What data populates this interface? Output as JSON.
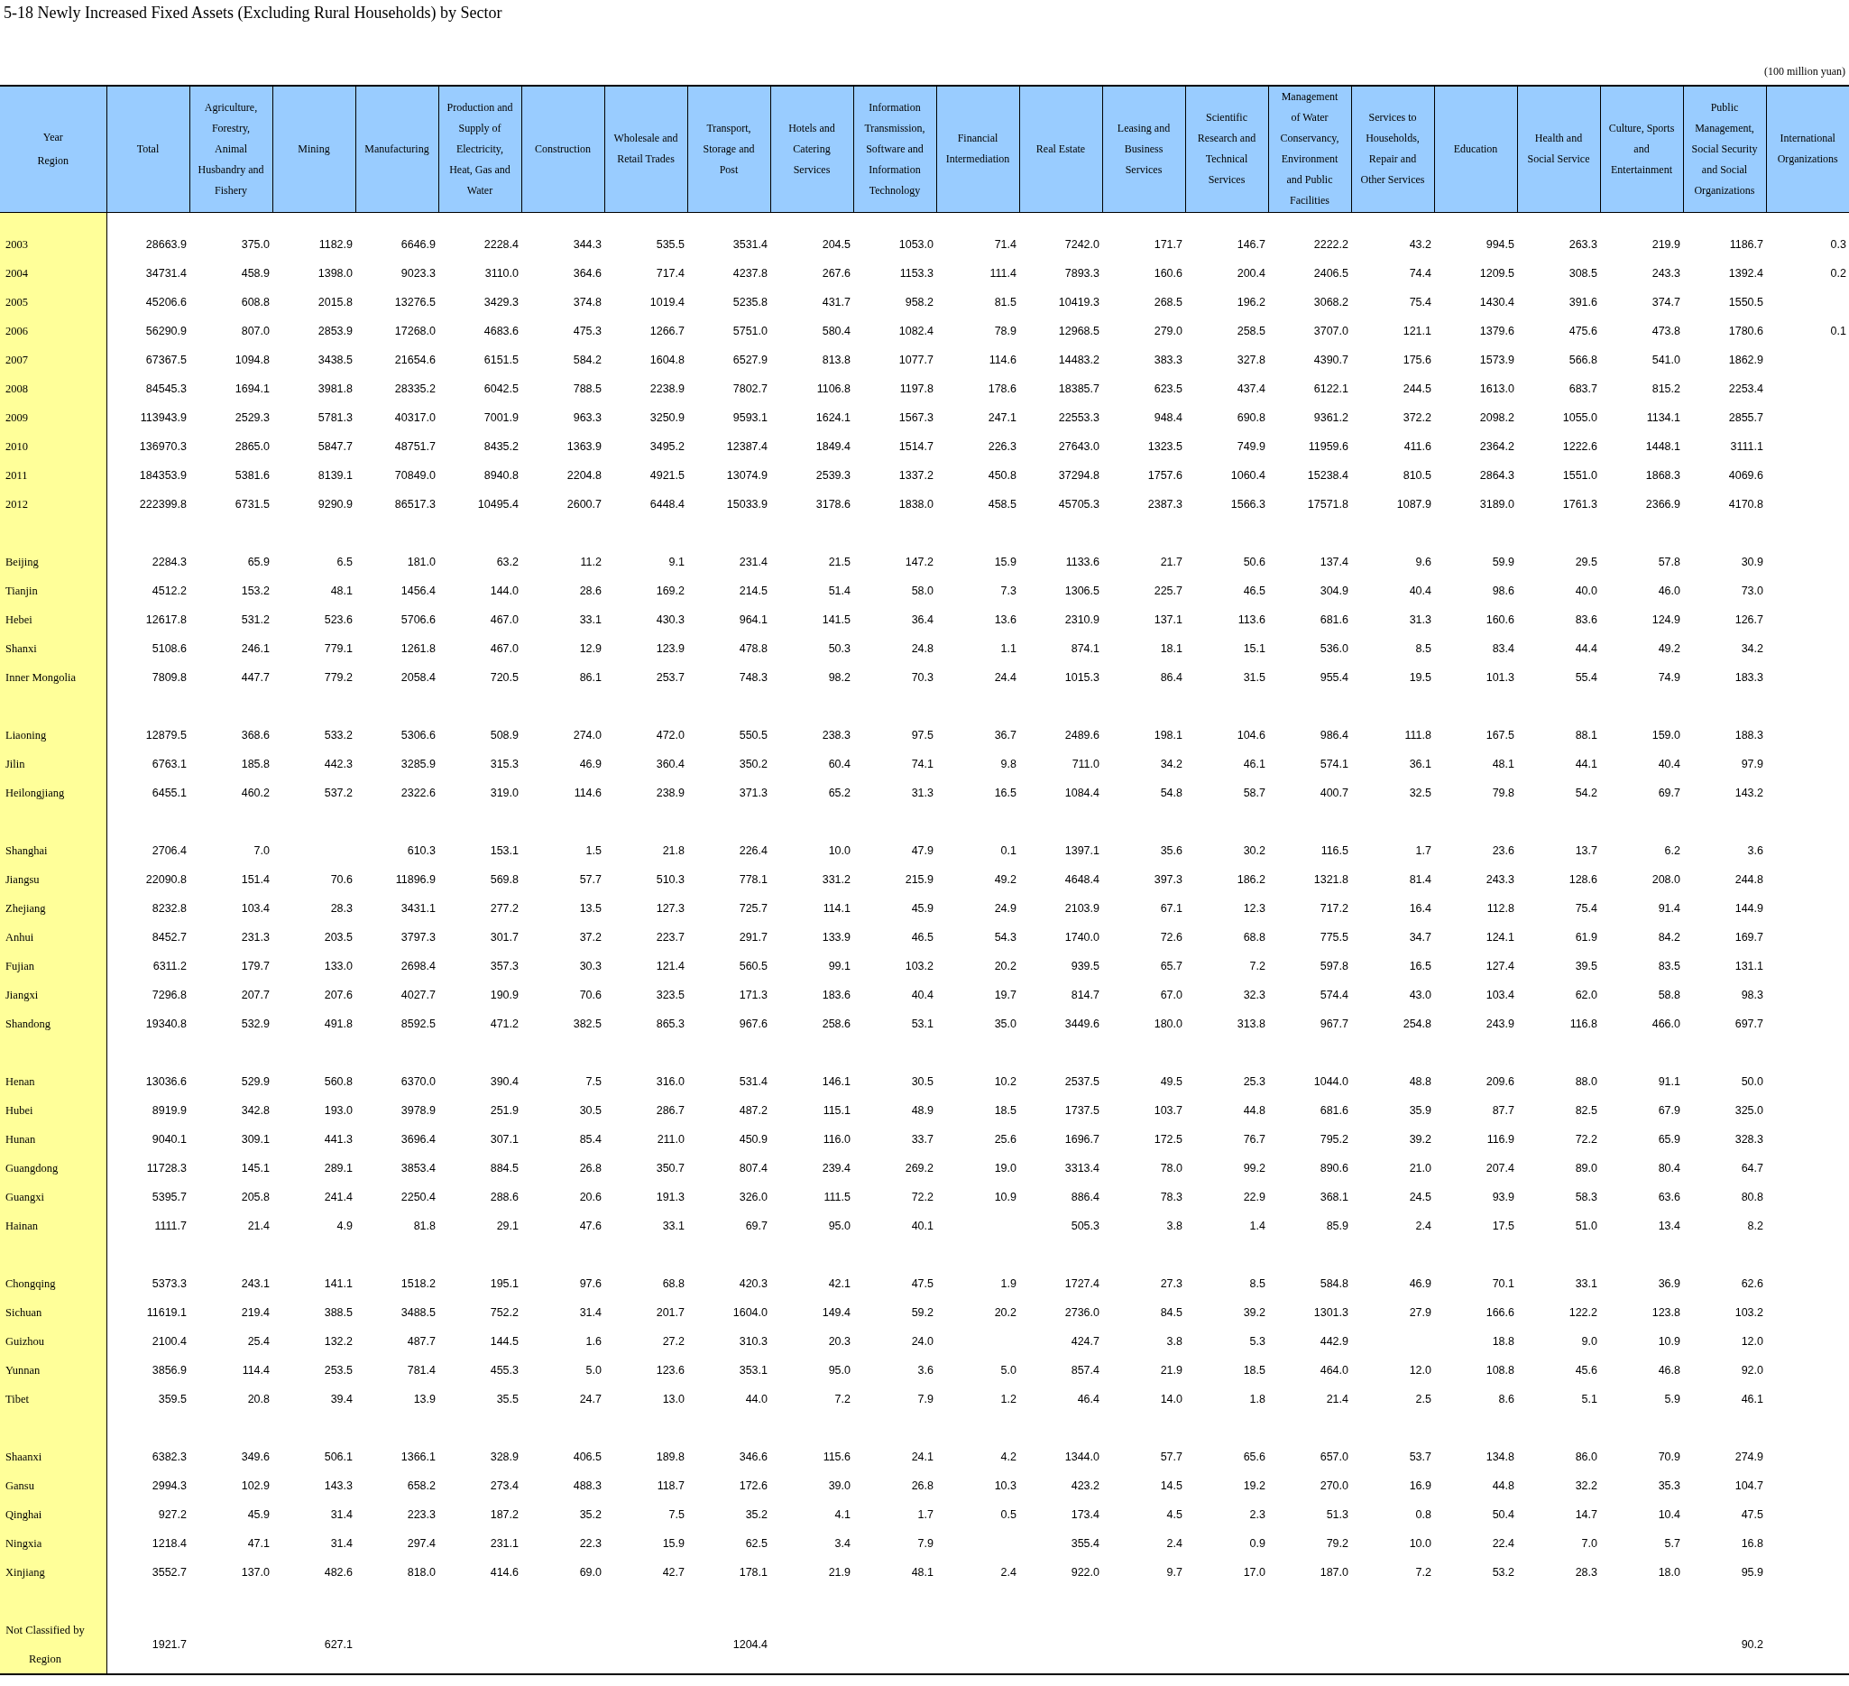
{
  "title": "5-18  Newly Increased Fixed Assets (Excluding Rural Households) by Sector",
  "unit_note": "(100 million yuan)",
  "corner_header": [
    "Year",
    "Region"
  ],
  "columns": [
    "Total",
    "Agriculture, Forestry, Animal Husbandry and Fishery",
    "Mining",
    "Manufacturing",
    "Production and Supply of Electricity, Heat, Gas and Water",
    "Construction",
    "Wholesale and Retail Trades",
    "Transport, Storage and Post",
    "Hotels and Catering Services",
    "Information Transmission, Software and Information Technology",
    "Financial Intermediation",
    "Real Estate",
    "Leasing and Business Services",
    "Scientific Research and Technical Services",
    "Management of Water Conservancy, Environment and Public Facilities",
    "Services to Households, Repair and Other Services",
    "Education",
    "Health and Social Service",
    "Culture, Sports and Entertainment",
    "Public Management, Social Security and Social Organizations",
    "International Organizations"
  ],
  "row_groups": [
    [
      {
        "label": "2003",
        "values": [
          "28663.9",
          "375.0",
          "1182.9",
          "6646.9",
          "2228.4",
          "344.3",
          "535.5",
          "3531.4",
          "204.5",
          "1053.0",
          "71.4",
          "7242.0",
          "171.7",
          "146.7",
          "2222.2",
          "43.2",
          "994.5",
          "263.3",
          "219.9",
          "1186.7",
          "0.3"
        ]
      },
      {
        "label": "2004",
        "values": [
          "34731.4",
          "458.9",
          "1398.0",
          "9023.3",
          "3110.0",
          "364.6",
          "717.4",
          "4237.8",
          "267.6",
          "1153.3",
          "111.4",
          "7893.3",
          "160.6",
          "200.4",
          "2406.5",
          "74.4",
          "1209.5",
          "308.5",
          "243.3",
          "1392.4",
          "0.2"
        ]
      },
      {
        "label": "2005",
        "values": [
          "45206.6",
          "608.8",
          "2015.8",
          "13276.5",
          "3429.3",
          "374.8",
          "1019.4",
          "5235.8",
          "431.7",
          "958.2",
          "81.5",
          "10419.3",
          "268.5",
          "196.2",
          "3068.2",
          "75.4",
          "1430.4",
          "391.6",
          "374.7",
          "1550.5"
        ]
      },
      {
        "label": "2006",
        "values": [
          "56290.9",
          "807.0",
          "2853.9",
          "17268.0",
          "4683.6",
          "475.3",
          "1266.7",
          "5751.0",
          "580.4",
          "1082.4",
          "78.9",
          "12968.5",
          "279.0",
          "258.5",
          "3707.0",
          "121.1",
          "1379.6",
          "475.6",
          "473.8",
          "1780.6",
          "0.1"
        ]
      },
      {
        "label": "2007",
        "values": [
          "67367.5",
          "1094.8",
          "3438.5",
          "21654.6",
          "6151.5",
          "584.2",
          "1604.8",
          "6527.9",
          "813.8",
          "1077.7",
          "114.6",
          "14483.2",
          "383.3",
          "327.8",
          "4390.7",
          "175.6",
          "1573.9",
          "566.8",
          "541.0",
          "1862.9"
        ]
      },
      {
        "label": "2008",
        "values": [
          "84545.3",
          "1694.1",
          "3981.8",
          "28335.2",
          "6042.5",
          "788.5",
          "2238.9",
          "7802.7",
          "1106.8",
          "1197.8",
          "178.6",
          "18385.7",
          "623.5",
          "437.4",
          "6122.1",
          "244.5",
          "1613.0",
          "683.7",
          "815.2",
          "2253.4"
        ]
      },
      {
        "label": "2009",
        "values": [
          "113943.9",
          "2529.3",
          "5781.3",
          "40317.0",
          "7001.9",
          "963.3",
          "3250.9",
          "9593.1",
          "1624.1",
          "1567.3",
          "247.1",
          "22553.3",
          "948.4",
          "690.8",
          "9361.2",
          "372.2",
          "2098.2",
          "1055.0",
          "1134.1",
          "2855.7"
        ]
      },
      {
        "label": "2010",
        "values": [
          "136970.3",
          "2865.0",
          "5847.7",
          "48751.7",
          "8435.2",
          "1363.9",
          "3495.2",
          "12387.4",
          "1849.4",
          "1514.7",
          "226.3",
          "27643.0",
          "1323.5",
          "749.9",
          "11959.6",
          "411.6",
          "2364.2",
          "1222.6",
          "1448.1",
          "3111.1"
        ]
      },
      {
        "label": "2011",
        "values": [
          "184353.9",
          "5381.6",
          "8139.1",
          "70849.0",
          "8940.8",
          "2204.8",
          "4921.5",
          "13074.9",
          "2539.3",
          "1337.2",
          "450.8",
          "37294.8",
          "1757.6",
          "1060.4",
          "15238.4",
          "810.5",
          "2864.3",
          "1551.0",
          "1868.3",
          "4069.6"
        ]
      },
      {
        "label": "2012",
        "values": [
          "222399.8",
          "6731.5",
          "9290.9",
          "86517.3",
          "10495.4",
          "2600.7",
          "6448.4",
          "15033.9",
          "3178.6",
          "1838.0",
          "458.5",
          "45705.3",
          "2387.3",
          "1566.3",
          "17571.8",
          "1087.9",
          "3189.0",
          "1761.3",
          "2366.9",
          "4170.8"
        ]
      }
    ],
    [
      {
        "label": "Beijing",
        "values": [
          "2284.3",
          "65.9",
          "6.5",
          "181.0",
          "63.2",
          "11.2",
          "9.1",
          "231.4",
          "21.5",
          "147.2",
          "15.9",
          "1133.6",
          "21.7",
          "50.6",
          "137.4",
          "9.6",
          "59.9",
          "29.5",
          "57.8",
          "30.9"
        ]
      },
      {
        "label": "Tianjin",
        "values": [
          "4512.2",
          "153.2",
          "48.1",
          "1456.4",
          "144.0",
          "28.6",
          "169.2",
          "214.5",
          "51.4",
          "58.0",
          "7.3",
          "1306.5",
          "225.7",
          "46.5",
          "304.9",
          "40.4",
          "98.6",
          "40.0",
          "46.0",
          "73.0"
        ]
      },
      {
        "label": "Hebei",
        "values": [
          "12617.8",
          "531.2",
          "523.6",
          "5706.6",
          "467.0",
          "33.1",
          "430.3",
          "964.1",
          "141.5",
          "36.4",
          "13.6",
          "2310.9",
          "137.1",
          "113.6",
          "681.6",
          "31.3",
          "160.6",
          "83.6",
          "124.9",
          "126.7"
        ]
      },
      {
        "label": "Shanxi",
        "values": [
          "5108.6",
          "246.1",
          "779.1",
          "1261.8",
          "467.0",
          "12.9",
          "123.9",
          "478.8",
          "50.3",
          "24.8",
          "1.1",
          "874.1",
          "18.1",
          "15.1",
          "536.0",
          "8.5",
          "83.4",
          "44.4",
          "49.2",
          "34.2"
        ]
      },
      {
        "label": "Inner Mongolia",
        "values": [
          "7809.8",
          "447.7",
          "779.2",
          "2058.4",
          "720.5",
          "86.1",
          "253.7",
          "748.3",
          "98.2",
          "70.3",
          "24.4",
          "1015.3",
          "86.4",
          "31.5",
          "955.4",
          "19.5",
          "101.3",
          "55.4",
          "74.9",
          "183.3"
        ]
      }
    ],
    [
      {
        "label": "Liaoning",
        "values": [
          "12879.5",
          "368.6",
          "533.2",
          "5306.6",
          "508.9",
          "274.0",
          "472.0",
          "550.5",
          "238.3",
          "97.5",
          "36.7",
          "2489.6",
          "198.1",
          "104.6",
          "986.4",
          "111.8",
          "167.5",
          "88.1",
          "159.0",
          "188.3"
        ]
      },
      {
        "label": "Jilin",
        "values": [
          "6763.1",
          "185.8",
          "442.3",
          "3285.9",
          "315.3",
          "46.9",
          "360.4",
          "350.2",
          "60.4",
          "74.1",
          "9.8",
          "711.0",
          "34.2",
          "46.1",
          "574.1",
          "36.1",
          "48.1",
          "44.1",
          "40.4",
          "97.9"
        ]
      },
      {
        "label": "Heilongjiang",
        "values": [
          "6455.1",
          "460.2",
          "537.2",
          "2322.6",
          "319.0",
          "114.6",
          "238.9",
          "371.3",
          "65.2",
          "31.3",
          "16.5",
          "1084.4",
          "54.8",
          "58.7",
          "400.7",
          "32.5",
          "79.8",
          "54.2",
          "69.7",
          "143.2"
        ]
      }
    ],
    [
      {
        "label": "Shanghai",
        "values": [
          "2706.4",
          "7.0",
          {
            "kind": "blank"
          },
          "610.3",
          "153.1",
          "1.5",
          "21.8",
          "226.4",
          "10.0",
          "47.9",
          "0.1",
          "1397.1",
          "35.6",
          "30.2",
          "116.5",
          "1.7",
          "23.6",
          "13.7",
          "6.2",
          "3.6"
        ]
      },
      {
        "label": "Jiangsu",
        "values": [
          "22090.8",
          "151.4",
          "70.6",
          "11896.9",
          "569.8",
          "57.7",
          "510.3",
          "778.1",
          "331.2",
          "215.9",
          "49.2",
          "4648.4",
          "397.3",
          "186.2",
          "1321.8",
          "81.4",
          "243.3",
          "128.6",
          "208.0",
          "244.8"
        ]
      },
      {
        "label": "Zhejiang",
        "values": [
          "8232.8",
          "103.4",
          "28.3",
          "3431.1",
          "277.2",
          "13.5",
          "127.3",
          "725.7",
          "114.1",
          "45.9",
          "24.9",
          "2103.9",
          "67.1",
          "12.3",
          "717.2",
          "16.4",
          "112.8",
          "75.4",
          "91.4",
          "144.9"
        ]
      },
      {
        "label": "Anhui",
        "values": [
          "8452.7",
          "231.3",
          "203.5",
          "3797.3",
          "301.7",
          "37.2",
          "223.7",
          "291.7",
          "133.9",
          "46.5",
          "54.3",
          "1740.0",
          "72.6",
          "68.8",
          "775.5",
          "34.7",
          "124.1",
          "61.9",
          "84.2",
          "169.7"
        ]
      },
      {
        "label": "Fujian",
        "values": [
          "6311.2",
          "179.7",
          "133.0",
          "2698.4",
          "357.3",
          "30.3",
          "121.4",
          "560.5",
          "99.1",
          "103.2",
          "20.2",
          "939.5",
          "65.7",
          "7.2",
          "597.8",
          "16.5",
          "127.4",
          "39.5",
          "83.5",
          "131.1"
        ]
      },
      {
        "label": "Jiangxi",
        "values": [
          "7296.8",
          "207.7",
          "207.6",
          "4027.7",
          "190.9",
          "70.6",
          "323.5",
          "171.3",
          "183.6",
          "40.4",
          "19.7",
          "814.7",
          "67.0",
          "32.3",
          "574.4",
          "43.0",
          "103.4",
          "62.0",
          "58.8",
          "98.3"
        ]
      },
      {
        "label": "Shandong",
        "values": [
          "19340.8",
          "532.9",
          "491.8",
          "8592.5",
          "471.2",
          "382.5",
          "865.3",
          "967.6",
          "258.6",
          "53.1",
          "35.0",
          "3449.6",
          "180.0",
          "313.8",
          "967.7",
          "254.8",
          "243.9",
          "116.8",
          "466.0",
          "697.7"
        ]
      }
    ],
    [
      {
        "label": "Henan",
        "values": [
          "13036.6",
          "529.9",
          "560.8",
          "6370.0",
          "390.4",
          "7.5",
          "316.0",
          "531.4",
          "146.1",
          "30.5",
          "10.2",
          "2537.5",
          "49.5",
          "25.3",
          "1044.0",
          "48.8",
          "209.6",
          "88.0",
          "91.1",
          "50.0"
        ]
      },
      {
        "label": "Hubei",
        "values": [
          "8919.9",
          "342.8",
          "193.0",
          "3978.9",
          "251.9",
          "30.5",
          "286.7",
          "487.2",
          "115.1",
          "48.9",
          "18.5",
          "1737.5",
          "103.7",
          "44.8",
          "681.6",
          "35.9",
          "87.7",
          "82.5",
          "67.9",
          "325.0"
        ]
      },
      {
        "label": "Hunan",
        "values": [
          "9040.1",
          "309.1",
          "441.3",
          "3696.4",
          "307.1",
          "85.4",
          "211.0",
          "450.9",
          "116.0",
          "33.7",
          "25.6",
          "1696.7",
          "172.5",
          "76.7",
          "795.2",
          "39.2",
          "116.9",
          "72.2",
          "65.9",
          "328.3"
        ]
      },
      {
        "label": "Guangdong",
        "values": [
          "11728.3",
          "145.1",
          "289.1",
          "3853.4",
          "884.5",
          "26.8",
          "350.7",
          "807.4",
          "239.4",
          "269.2",
          "19.0",
          "3313.4",
          "78.0",
          "99.2",
          "890.6",
          "21.0",
          "207.4",
          "89.0",
          "80.4",
          "64.7"
        ]
      },
      {
        "label": "Guangxi",
        "values": [
          "5395.7",
          "205.8",
          "241.4",
          "2250.4",
          "288.6",
          "20.6",
          "191.3",
          "326.0",
          "111.5",
          "72.2",
          "10.9",
          "886.4",
          "78.3",
          "22.9",
          "368.1",
          "24.5",
          "93.9",
          "58.3",
          "63.6",
          "80.8"
        ]
      },
      {
        "label": "Hainan",
        "values": [
          "1111.7",
          "21.4",
          "4.9",
          "81.8",
          "29.1",
          "47.6",
          "33.1",
          "69.7",
          "95.0",
          "40.1",
          {
            "kind": "blank"
          },
          "505.3",
          "3.8",
          "1.4",
          "85.9",
          "2.4",
          "17.5",
          "51.0",
          "13.4",
          "8.2"
        ]
      }
    ],
    [
      {
        "label": "Chongqing",
        "values": [
          "5373.3",
          "243.1",
          "141.1",
          "1518.2",
          "195.1",
          "97.6",
          "68.8",
          "420.3",
          "42.1",
          "47.5",
          "1.9",
          "1727.4",
          "27.3",
          "8.5",
          "584.8",
          "46.9",
          "70.1",
          "33.1",
          "36.9",
          "62.6"
        ]
      },
      {
        "label": "Sichuan",
        "values": [
          "11619.1",
          "219.4",
          "388.5",
          "3488.5",
          "752.2",
          "31.4",
          "201.7",
          "1604.0",
          "149.4",
          "59.2",
          "20.2",
          "2736.0",
          "84.5",
          "39.2",
          "1301.3",
          "27.9",
          "166.6",
          "122.2",
          "123.8",
          "103.2"
        ]
      },
      {
        "label": "Guizhou",
        "values": [
          "2100.4",
          "25.4",
          "132.2",
          "487.7",
          "144.5",
          "1.6",
          "27.2",
          "310.3",
          "20.3",
          "24.0",
          {
            "kind": "blank"
          },
          "424.7",
          "3.8",
          "5.3",
          "442.9",
          {
            "kind": "blank"
          },
          "18.8",
          "9.0",
          "10.9",
          "12.0"
        ]
      },
      {
        "label": "Yunnan",
        "values": [
          "3856.9",
          "114.4",
          "253.5",
          "781.4",
          "455.3",
          "5.0",
          "123.6",
          "353.1",
          "95.0",
          "3.6",
          "5.0",
          "857.4",
          "21.9",
          "18.5",
          "464.0",
          "12.0",
          "108.8",
          "45.6",
          "46.8",
          "92.0"
        ]
      },
      {
        "label": "Tibet",
        "values": [
          "359.5",
          "20.8",
          "39.4",
          "13.9",
          "35.5",
          "24.7",
          "13.0",
          "44.0",
          "7.2",
          "7.9",
          "1.2",
          "46.4",
          "14.0",
          "1.8",
          "21.4",
          "2.5",
          "8.6",
          "5.1",
          "5.9",
          "46.1"
        ]
      }
    ],
    [
      {
        "label": "Shaanxi",
        "values": [
          "6382.3",
          "349.6",
          "506.1",
          "1366.1",
          "328.9",
          "406.5",
          "189.8",
          "346.6",
          "115.6",
          "24.1",
          "4.2",
          "1344.0",
          "57.7",
          "65.6",
          "657.0",
          "53.7",
          "134.8",
          "86.0",
          "70.9",
          "274.9"
        ]
      },
      {
        "label": "Gansu",
        "values": [
          "2994.3",
          "102.9",
          "143.3",
          "658.2",
          "273.4",
          "488.3",
          "118.7",
          "172.6",
          "39.0",
          "26.8",
          "10.3",
          "423.2",
          "14.5",
          "19.2",
          "270.0",
          "16.9",
          "44.8",
          "32.2",
          "35.3",
          "104.7"
        ]
      },
      {
        "label": "Qinghai",
        "values": [
          "927.2",
          "45.9",
          "31.4",
          "223.3",
          "187.2",
          "35.2",
          "7.5",
          "35.2",
          "4.1",
          "1.7",
          "0.5",
          "173.4",
          "4.5",
          "2.3",
          "51.3",
          "0.8",
          "50.4",
          "14.7",
          "10.4",
          "47.5"
        ]
      },
      {
        "label": "Ningxia",
        "values": [
          "1218.4",
          "47.1",
          "31.4",
          "297.4",
          "231.1",
          "22.3",
          "15.9",
          "62.5",
          "3.4",
          "7.9",
          {
            "kind": "blank"
          },
          "355.4",
          "2.4",
          "0.9",
          "79.2",
          "10.0",
          "22.4",
          "7.0",
          "5.7",
          "16.8"
        ]
      },
      {
        "label": "Xinjiang",
        "values": [
          "3552.7",
          "137.0",
          "482.6",
          "818.0",
          "414.6",
          "69.0",
          "42.7",
          "178.1",
          "21.9",
          "48.1",
          "2.4",
          "922.0",
          "9.7",
          "17.0",
          "187.0",
          "7.2",
          "53.2",
          "28.3",
          "18.0",
          "95.9"
        ]
      }
    ],
    [
      {
        "label": "Not Classified by Region",
        "values": [
          "1921.7",
          {
            "kind": "blank"
          },
          "627.1",
          {
            "kind": "blank"
          },
          {
            "kind": "blank"
          },
          {
            "kind": "blank"
          },
          {
            "kind": "blank"
          },
          "1204.4",
          {
            "kind": "blank"
          },
          {
            "kind": "blank"
          },
          {
            "kind": "blank"
          },
          {
            "kind": "blank"
          },
          {
            "kind": "blank"
          },
          {
            "kind": "blank"
          },
          {
            "kind": "blank"
          },
          {
            "kind": "blank"
          },
          {
            "kind": "blank"
          },
          {
            "kind": "blank"
          },
          {
            "kind": "blank"
          },
          "90.2"
        ]
      }
    ]
  ]
}
